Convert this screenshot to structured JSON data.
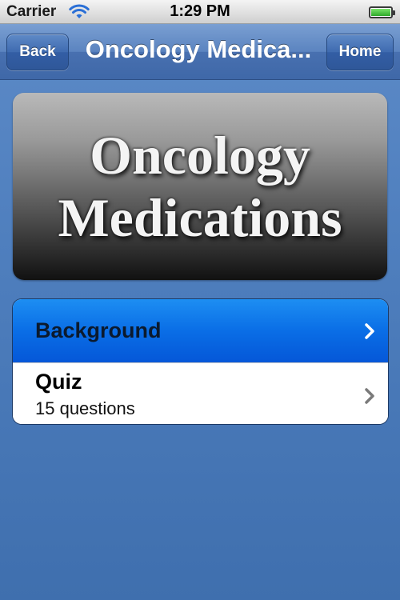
{
  "status_bar": {
    "carrier": "Carrier",
    "time": "1:29 PM",
    "wifi_icon": "wifi-icon",
    "battery_icon": "battery-icon"
  },
  "nav": {
    "back_label": "Back",
    "title": "Oncology Medica...",
    "home_label": "Home",
    "bar_color": "#4f78b8"
  },
  "banner": {
    "line1": "Oncology",
    "line2": "Medications"
  },
  "menu": {
    "items": [
      {
        "title": "Background",
        "subtitle": "",
        "selected": true,
        "icon": "chevron-right-icon"
      },
      {
        "title": "Quiz",
        "subtitle": "15 questions",
        "selected": false,
        "icon": "chevron-right-icon"
      }
    ],
    "selected_color": "#0a6ee6"
  }
}
